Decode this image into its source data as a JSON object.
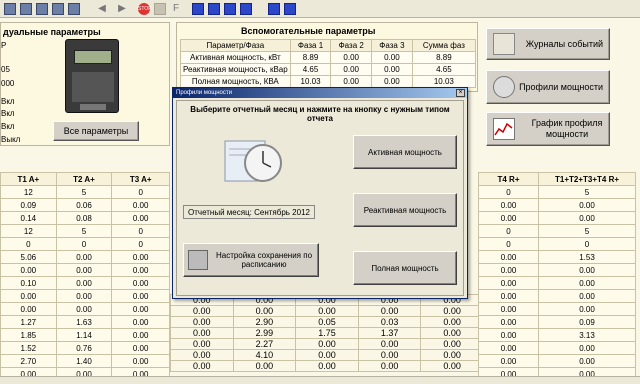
{
  "toolbar": {
    "icons": [
      "save-icon",
      "open-icon",
      "print-icon",
      "grid-icon",
      "table-icon",
      "back-arrow-icon",
      "forward-arrow-icon",
      "stop-icon",
      "report-icon",
      "calendar-icon",
      "window-icon",
      "info-icon",
      "exit-icon"
    ],
    "stop_label": "STOP",
    "f_label": "F"
  },
  "left_panel": {
    "title": "дуальные параметры",
    "codes": [
      "P",
      "05",
      "000"
    ],
    "status": [
      "Вкл",
      "Вкл",
      "Вкл",
      "Выкл"
    ],
    "all_params_button": "Все параметры"
  },
  "aux": {
    "title": "Вспомогательные параметры",
    "headers": [
      "Параметр/Фаза",
      "Фаза 1",
      "Фаза 2",
      "Фаза 3",
      "Сумма фаз"
    ],
    "rows": [
      [
        "Активная мощность, кВт",
        "8.89",
        "0.00",
        "0.00",
        "8.89"
      ],
      [
        "Реактивная мощность, кВар",
        "4.65",
        "0.00",
        "0.00",
        "4.65"
      ],
      [
        "Полная мощность, КВА",
        "10.03",
        "0.00",
        "0.00",
        "10.03"
      ]
    ]
  },
  "right_buttons": {
    "events": "Журналы событий",
    "profiles": "Профили мощности",
    "graph": "График профиля мощности"
  },
  "main_table": {
    "headers": [
      "T1 A+",
      "T2 A+",
      "T3 A+"
    ],
    "rows": [
      [
        "12",
        "5",
        "0"
      ],
      [
        "0.09",
        "0.06",
        "0.00"
      ],
      [
        "0.14",
        "0.08",
        "0.00"
      ],
      [
        "12",
        "5",
        "0"
      ],
      [
        "0",
        "0",
        "0"
      ],
      [
        "5.06",
        "0.00",
        "0.00"
      ],
      [
        "0.00",
        "0.00",
        "0.00"
      ],
      [
        "0.10",
        "0.00",
        "0.00"
      ],
      [
        "0.00",
        "0.00",
        "0.00"
      ],
      [
        "0.00",
        "0.00",
        "0.00"
      ],
      [
        "1.27",
        "1.63",
        "0.00"
      ],
      [
        "1.85",
        "1.14",
        "0.00"
      ],
      [
        "1.52",
        "0.76",
        "0.00"
      ],
      [
        "2.70",
        "1.40",
        "0.00"
      ],
      [
        "0.00",
        "0.00",
        "0.00"
      ]
    ]
  },
  "mid_visible_rows": [
    [
      "0.00",
      "0.00",
      "0.00",
      "0.00",
      "0.00"
    ],
    [
      "0.00",
      "0.00",
      "0.00",
      "0.00",
      "0.00"
    ],
    [
      "0.00",
      "2.90",
      "0.05",
      "0.03",
      "0.00"
    ],
    [
      "0.00",
      "2.99",
      "1.75",
      "1.37",
      "0.00"
    ],
    [
      "0.00",
      "2.27",
      "0.00",
      "0.00",
      "0.00"
    ],
    [
      "0.00",
      "4.10",
      "0.00",
      "0.00",
      "0.00"
    ],
    [
      "0.00",
      "0.00",
      "0.00",
      "0.00",
      "0.00"
    ]
  ],
  "right_table": {
    "headers": [
      "T4 R+",
      "T1+T2+T3+T4 R+"
    ],
    "rows": [
      [
        "0",
        "5"
      ],
      [
        "0.00",
        "0.00"
      ],
      [
        "0.00",
        "0.00"
      ],
      [
        "0",
        "5"
      ],
      [
        "0",
        "0"
      ],
      [
        "0.00",
        "1.53"
      ],
      [
        "0.00",
        "0.00"
      ],
      [
        "0.00",
        "0.00"
      ],
      [
        "0.00",
        "0.00"
      ],
      [
        "0.00",
        "0.00"
      ],
      [
        "0.00",
        "0.09"
      ],
      [
        "0.00",
        "3.13"
      ],
      [
        "0.00",
        "0.00"
      ],
      [
        "0.00",
        "0.00"
      ],
      [
        "0.00",
        "0.00"
      ]
    ]
  },
  "dialog": {
    "title": "Профили мощности",
    "instruction": "Выберите отчетный месяц и нажмите на кнопку с нужным типом отчета",
    "month_label": "Отчетный месяц: Сентябрь 2012",
    "schedule_button": "Настройка сохранения по расписанию",
    "active_button": "Активная мощность",
    "reactive_button": "Реактивная мощность",
    "full_button": "Полная мощность"
  }
}
